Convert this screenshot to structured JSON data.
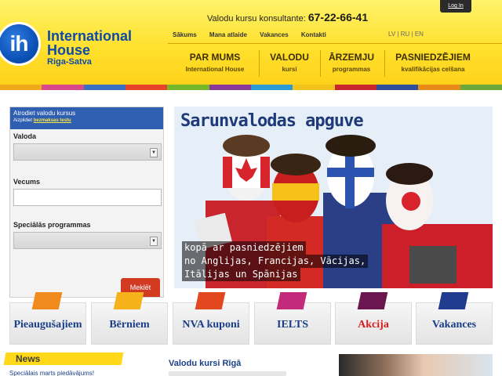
{
  "header": {
    "login_label": "Log In",
    "consultant_prefix": "Valodu kursu konsultante:",
    "consultant_phone": "67-22-66-41",
    "logo": {
      "mark": "ih",
      "line1": "International",
      "line2": "House",
      "line3": "Riga-Satva"
    },
    "top_nav": [
      "Sākums",
      "Mana atlaide",
      "Vakances",
      "Kontakti"
    ],
    "languages": [
      "LV",
      "RU",
      "EN"
    ],
    "main_nav": [
      {
        "title": "PAR MUMS",
        "subtitle": "International House"
      },
      {
        "title": "VALODU",
        "subtitle": "kursi"
      },
      {
        "title": "ĀRZEMJU",
        "subtitle": "programmas"
      },
      {
        "title": "PASNIEDZĒJIEM",
        "subtitle": "kvalifikācijas celšana"
      }
    ]
  },
  "colorbar": [
    "#f2a81d",
    "#d94a8a",
    "#3a6fc1",
    "#e8442a",
    "#76b82a",
    "#8a3a9b",
    "#2a9bd6",
    "#f2c21d",
    "#c9262f",
    "#2f4f9a",
    "#e98b1a",
    "#6fa83a"
  ],
  "search": {
    "title": "Atrodiet valodu kursus",
    "hint_prefix": "Aizpildiet",
    "hint_link": "bezmaksas testu",
    "field_language": "Valoda",
    "field_age": "Vecums",
    "field_programs": "Speciālās programmas",
    "submit_label": "Meklēt"
  },
  "banner": {
    "title": "Sarunvalodas apguve",
    "caption": [
      "kopā ar pasniedzējiem",
      "no Anglijas, Francijas, Vācijas,",
      "Itālijas un Spānijas"
    ]
  },
  "tiles": [
    {
      "label": "Pieaugušajiem",
      "color": "#f08a1c",
      "red": false
    },
    {
      "label": "Bērniem",
      "color": "#f5b21a",
      "red": false
    },
    {
      "label": "NVA kuponi",
      "color": "#e3471f",
      "red": false
    },
    {
      "label": "IELTS",
      "color": "#c42a7c",
      "red": false
    },
    {
      "label": "Akcija",
      "color": "#6b1650",
      "red": true
    },
    {
      "label": "Vakances",
      "color": "#1f3c91",
      "red": false
    }
  ],
  "news": {
    "label": "News",
    "first_item": "Speciālais marts piedāvājums!"
  },
  "courses_heading": "Valodu kursi Rīgā"
}
